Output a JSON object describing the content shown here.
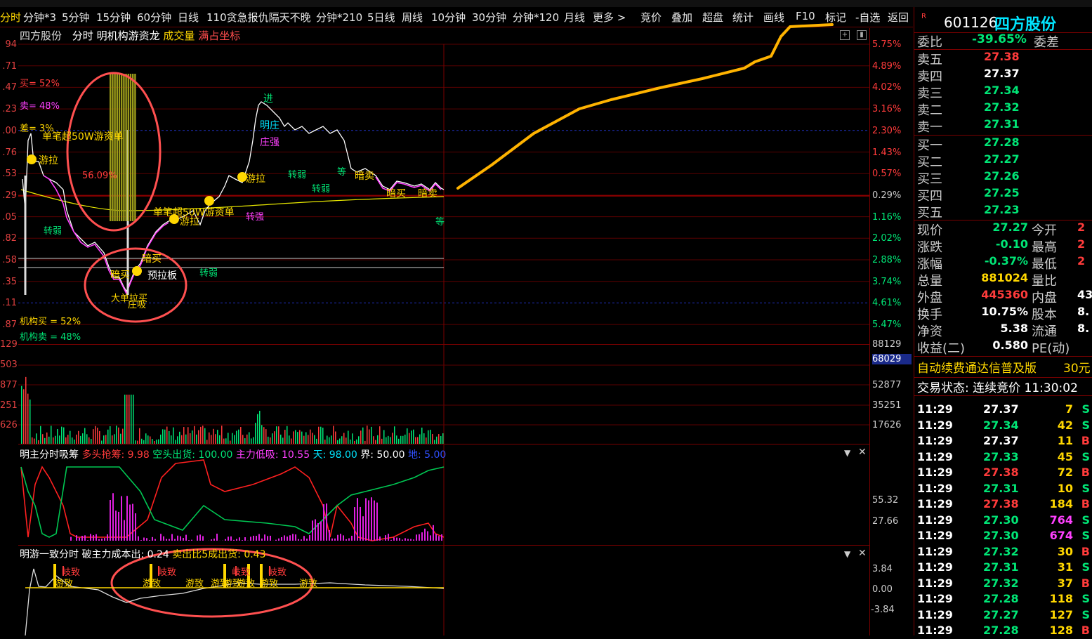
{
  "toolbar": {
    "items": [
      "分时",
      "分钟*3",
      "5分钟",
      "15分钟",
      "60分钟",
      "日线",
      "110贪急报仇隔天不晚",
      "分钟*210",
      "5日线",
      "周线",
      "10分钟",
      "30分钟",
      "分钟*120",
      "月线",
      "更多 >"
    ],
    "right_items": [
      "竞价",
      "叠加",
      "超盘",
      "统计",
      "画线",
      "F10",
      "标记",
      "-自选",
      "返回"
    ]
  },
  "chart_header": {
    "stock_name": "四方股份",
    "mode": "分时",
    "indicator": "明机构游资龙",
    "volume_label": "成交量",
    "coord_label": "满占坐标"
  },
  "price_axis_left": [
    "94",
    ".71",
    ".47",
    ".23",
    ".00",
    ".76",
    ".53",
    ".29",
    ".05",
    ".82",
    ".58",
    ".35",
    ".11",
    ".87"
  ],
  "price_axis_right": [
    "5.75%",
    "4.89%",
    "4.02%",
    "3.16%",
    "2.30%",
    "1.43%",
    "0.57%",
    "0.29%",
    "1.16%",
    "2.02%",
    "2.88%",
    "3.74%",
    "4.61%",
    "5.47%"
  ],
  "volume_axis_left": [
    "129",
    "503",
    "877",
    "251",
    "626"
  ],
  "volume_axis_right": [
    "88129",
    "68029",
    "52877",
    "35251",
    "17626"
  ],
  "chart_labels": {
    "buy_pct": "买= 52%",
    "sell_pct": "卖= 48%",
    "diff_pct": "差= 3%",
    "big_order": "单笔超50W游资单",
    "youla": "游拉",
    "hold_pct": "56.09%",
    "inst_buy": "机构买 = 52%",
    "inst_sell": "机构卖 = 48%",
    "an_mai": "暗买",
    "yu_la_ban": "预拉板",
    "da_dan_mai": "大单拉买",
    "zhuang_xi": "庄吸",
    "zhuang_qiang": "庄强",
    "zhuan_ruo": "转弱",
    "deng": "等",
    "an_mai2": "暗卖",
    "danbi": "单笔超50W游资单",
    "zhuan_qiang": "转强",
    "ming_zhuang": "明庄",
    "jin": "进"
  },
  "indicator2": {
    "title": "明主分时吸筹",
    "duo": "多头抢筹: 9.98",
    "kong": "空头出货: 100.00",
    "zhuli": "主力低吸: 10.55",
    "tian": "天: 98.00",
    "jie": "界: 50.00",
    "di": "地: 5.00",
    "axis": [
      "55.32",
      "27.66"
    ]
  },
  "indicator3": {
    "title": "明游一致分时",
    "po": "破主力成本出: 0.24",
    "mai": "卖出比5成出货: 0.43",
    "axis": [
      "3.84",
      "0.00",
      "-3.84"
    ],
    "tag_a": "游致",
    "tag_b": "岐致"
  },
  "quote": {
    "code": "601126",
    "name": "四方股份",
    "weibi_label": "委比",
    "weibi": "-39.65%",
    "weicha_label": "委差",
    "asks": [
      {
        "label": "卖五",
        "price": "27.38"
      },
      {
        "label": "卖四",
        "price": "27.37"
      },
      {
        "label": "卖三",
        "price": "27.34"
      },
      {
        "label": "卖二",
        "price": "27.32"
      },
      {
        "label": "卖一",
        "price": "27.31"
      }
    ],
    "bids": [
      {
        "label": "买一",
        "price": "27.28"
      },
      {
        "label": "买二",
        "price": "27.27"
      },
      {
        "label": "买三",
        "price": "27.26"
      },
      {
        "label": "买四",
        "price": "27.25"
      },
      {
        "label": "买五",
        "price": "27.23"
      }
    ],
    "stats": [
      {
        "l1": "现价",
        "v1": "27.27",
        "l2": "今开",
        "c1": "g"
      },
      {
        "l1": "涨跌",
        "v1": "-0.10",
        "l2": "最高",
        "c1": "g"
      },
      {
        "l1": "涨幅",
        "v1": "-0.37%",
        "l2": "最低",
        "c1": "g"
      },
      {
        "l1": "总量",
        "v1": "881024",
        "l2": "量比",
        "c1": "y"
      },
      {
        "l1": "外盘",
        "v1": "445360",
        "l2": "内盘",
        "c1": "r"
      },
      {
        "l1": "换手",
        "v1": "10.75%",
        "l2": "股本",
        "c1": "w"
      },
      {
        "l1": "净资",
        "v1": "5.38",
        "l2": "流通",
        "c1": "w"
      },
      {
        "l1": "收益(二)",
        "v1": "0.580",
        "l2": "PE(动)",
        "c1": "w"
      }
    ],
    "stats_right": [
      "2",
      "2",
      "2",
      "",
      "43",
      "8.",
      "8.",
      ""
    ],
    "ad": "自动续费通达信普及版",
    "ad_price": "30元",
    "status": "交易状态: 连续竞价 11:30:02",
    "trades": [
      {
        "t": "11:29",
        "p": "27.37",
        "v": "7",
        "s": "S",
        "pc": "w",
        "vc": "y"
      },
      {
        "t": "11:29",
        "p": "27.34",
        "v": "42",
        "s": "S",
        "pc": "g",
        "vc": "y"
      },
      {
        "t": "11:29",
        "p": "27.37",
        "v": "11",
        "s": "B",
        "pc": "w",
        "vc": "y"
      },
      {
        "t": "11:29",
        "p": "27.33",
        "v": "45",
        "s": "S",
        "pc": "g",
        "vc": "y"
      },
      {
        "t": "11:29",
        "p": "27.38",
        "v": "72",
        "s": "B",
        "pc": "r",
        "vc": "y"
      },
      {
        "t": "11:29",
        "p": "27.31",
        "v": "10",
        "s": "S",
        "pc": "g",
        "vc": "y"
      },
      {
        "t": "11:29",
        "p": "27.38",
        "v": "184",
        "s": "B",
        "pc": "r",
        "vc": "y"
      },
      {
        "t": "11:29",
        "p": "27.30",
        "v": "764",
        "s": "S",
        "pc": "g",
        "vc": "m"
      },
      {
        "t": "11:29",
        "p": "27.30",
        "v": "674",
        "s": "S",
        "pc": "g",
        "vc": "m"
      },
      {
        "t": "11:29",
        "p": "27.32",
        "v": "30",
        "s": "B",
        "pc": "g",
        "vc": "y"
      },
      {
        "t": "11:29",
        "p": "27.31",
        "v": "31",
        "s": "S",
        "pc": "g",
        "vc": "y"
      },
      {
        "t": "11:29",
        "p": "27.32",
        "v": "37",
        "s": "B",
        "pc": "g",
        "vc": "y"
      },
      {
        "t": "11:29",
        "p": "27.28",
        "v": "118",
        "s": "S",
        "pc": "g",
        "vc": "y"
      },
      {
        "t": "11:29",
        "p": "27.27",
        "v": "127",
        "s": "S",
        "pc": "g",
        "vc": "y"
      },
      {
        "t": "11:29",
        "p": "27.28",
        "v": "128",
        "s": "B",
        "pc": "g",
        "vc": "y"
      }
    ]
  },
  "colors": {
    "up": "#ff3b3b",
    "down": "#00e676",
    "accent": "#ffd700",
    "annotation": "#ff4d4d",
    "trend": "#ffb300"
  }
}
